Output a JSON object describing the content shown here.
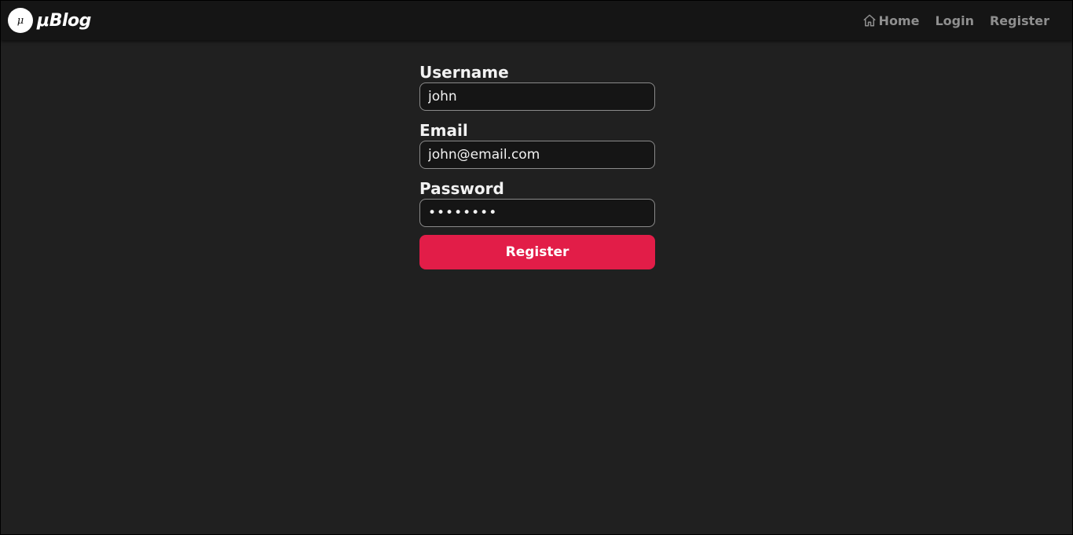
{
  "navbar": {
    "brand": {
      "logo_glyph": "μ",
      "name": "μBlog"
    },
    "links": [
      {
        "label": "Home",
        "icon": "home-icon"
      },
      {
        "label": "Login"
      },
      {
        "label": "Register"
      }
    ]
  },
  "form": {
    "username": {
      "label": "Username",
      "value": "john"
    },
    "email": {
      "label": "Email",
      "value": "john@email.com"
    },
    "password": {
      "label": "Password",
      "value": "password"
    },
    "submit_label": "Register"
  },
  "colors": {
    "background": "#202020",
    "navbar": "#151515",
    "accent": "#e21d48",
    "nav_text": "#8f8f8f"
  }
}
